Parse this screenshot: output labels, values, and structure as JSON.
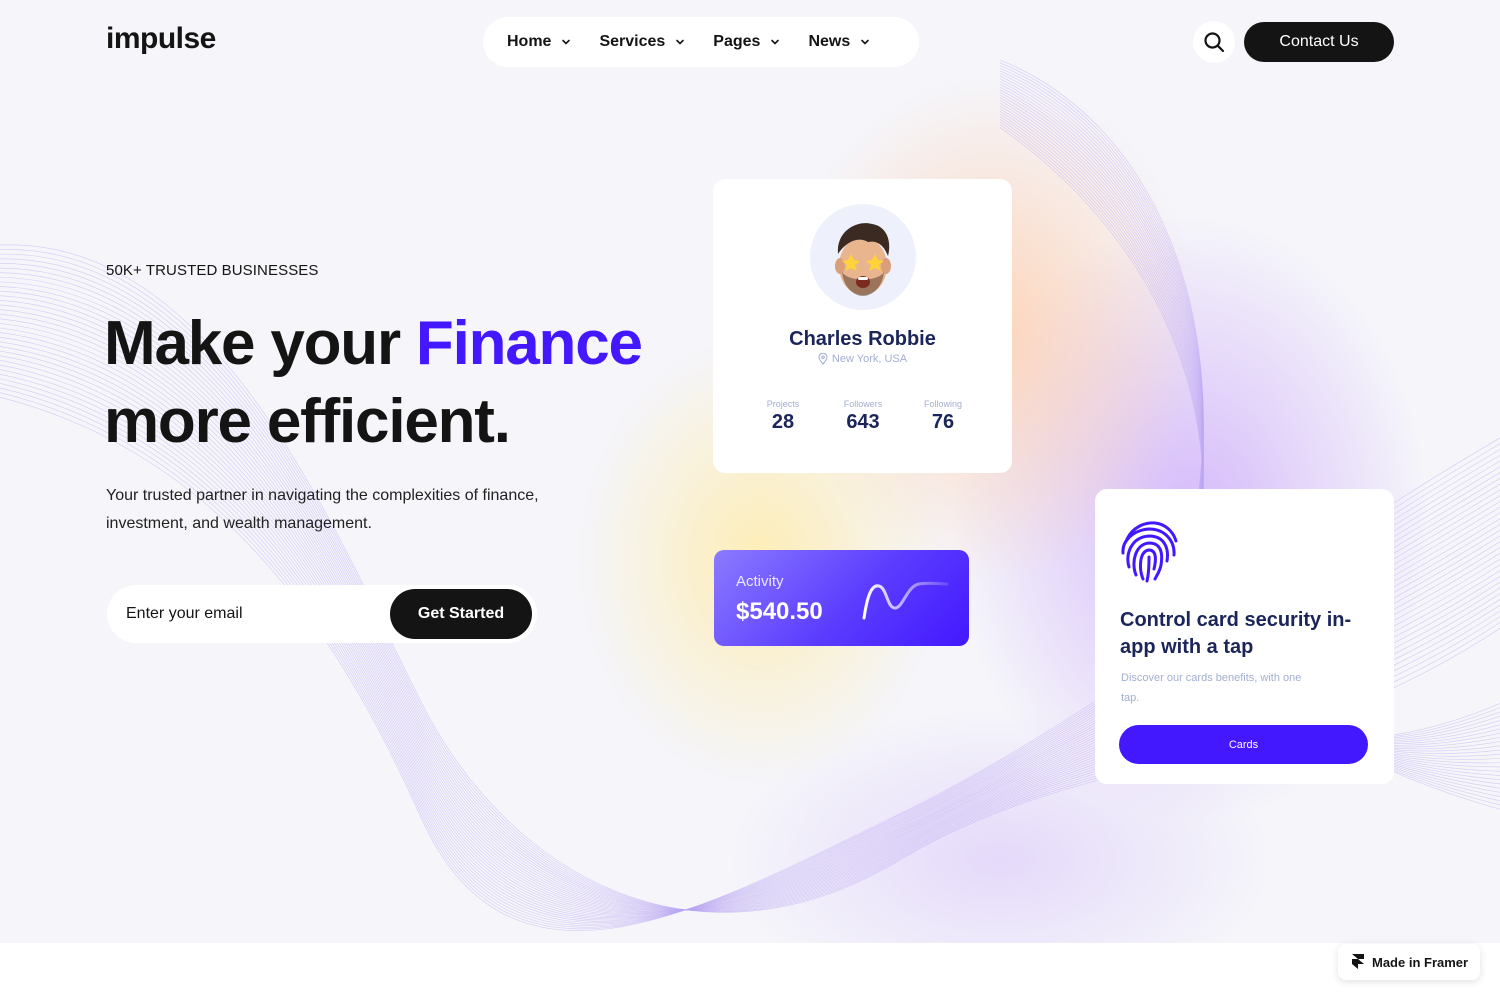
{
  "header": {
    "logo": "impulse",
    "nav": [
      {
        "label": "Home"
      },
      {
        "label": "Services"
      },
      {
        "label": "Pages"
      },
      {
        "label": "News"
      }
    ],
    "contact_label": "Contact Us"
  },
  "hero": {
    "eyebrow": "50K+ TRUSTED BUSINESSES",
    "headline_part1": "Make your ",
    "headline_accent": "Finance",
    "headline_part2": "more efficient.",
    "subtext": "Your trusted partner in navigating the complexities of finance, investment, and wealth management.",
    "email_placeholder": "Enter your email",
    "cta_label": "Get Started"
  },
  "profile": {
    "name": "Charles Robbie",
    "location": "New York, USA",
    "stats": [
      {
        "label": "Projects",
        "value": "28"
      },
      {
        "label": "Followers",
        "value": "643"
      },
      {
        "label": "Following",
        "value": "76"
      }
    ]
  },
  "activity": {
    "label": "Activity",
    "value": "$540.50"
  },
  "security": {
    "title": "Control card security in-app with a tap",
    "description": "Discover our cards benefits, with one tap.",
    "button_label": "Cards"
  },
  "badge": {
    "label": "Made in Framer"
  },
  "colors": {
    "accent": "#4318ff",
    "dark": "#141414",
    "navy": "#1b2559",
    "muted": "#a3aed0"
  }
}
